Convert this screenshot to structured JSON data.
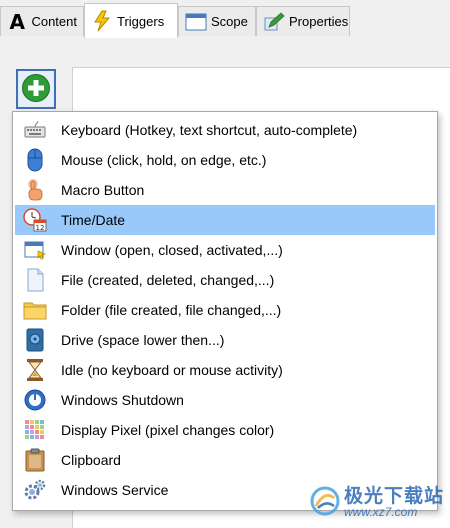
{
  "tabs": [
    {
      "id": "content",
      "label": "Content",
      "icon": "letter-a-icon",
      "active": false
    },
    {
      "id": "triggers",
      "label": "Triggers",
      "icon": "lightning-bolt-icon",
      "active": true
    },
    {
      "id": "scope",
      "label": "Scope",
      "icon": "window-icon",
      "active": false
    },
    {
      "id": "properties",
      "label": "Properties",
      "icon": "edit-pencil-icon",
      "active": false
    }
  ],
  "content": {
    "tab_icon_letter": "A"
  },
  "add_button": {
    "icon": "plus-circle-icon",
    "accent": "#2e9c36"
  },
  "menu": {
    "selected_index": 3,
    "selected_color": "#99c9fb",
    "items": [
      {
        "label": "Keyboard (Hotkey, text shortcut, auto-complete)",
        "icon": "keyboard-icon"
      },
      {
        "label": "Mouse (click, hold, on edge, etc.)",
        "icon": "mouse-icon"
      },
      {
        "label": "Macro Button",
        "icon": "hand-pointer-icon"
      },
      {
        "label": "Time/Date",
        "icon": "clock-calendar-icon",
        "calendar_day": "12"
      },
      {
        "label": "Window (open, closed, activated,...)",
        "icon": "window-icon"
      },
      {
        "label": "File (created, deleted, changed,...)",
        "icon": "file-icon"
      },
      {
        "label": "Folder (file created, file changed,...)",
        "icon": "folder-icon"
      },
      {
        "label": "Drive (space lower then...)",
        "icon": "drive-icon"
      },
      {
        "label": "Idle (no keyboard or mouse activity)",
        "icon": "hourglass-icon"
      },
      {
        "label": "Windows Shutdown",
        "icon": "power-icon"
      },
      {
        "label": "Display Pixel (pixel changes color)",
        "icon": "pixel-grid-icon"
      },
      {
        "label": "Clipboard",
        "icon": "clipboard-icon"
      },
      {
        "label": "Windows Service",
        "icon": "gears-icon"
      }
    ]
  },
  "watermark": {
    "title": "极光下载站",
    "url": "www.xz7.com",
    "icon": "aurora-logo-icon"
  }
}
